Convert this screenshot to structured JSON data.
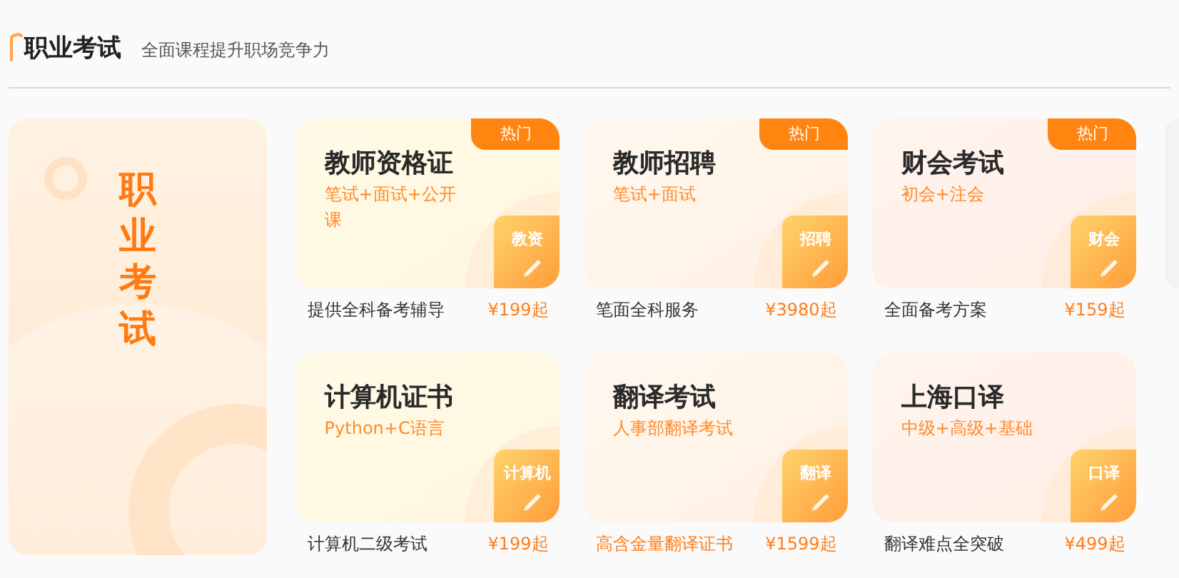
{
  "header": {
    "title": "职业考试",
    "subtitle": "全面课程提升职场竞争力"
  },
  "banner": {
    "title": "职业考试"
  },
  "cards": [
    {
      "title": "教师资格证",
      "subtitle": "笔试+面试+公开课",
      "badge": "热门",
      "icon_label": "教资",
      "caption": "提供全科备考辅导",
      "price": "¥199起",
      "highlighted": false
    },
    {
      "title": "教师招聘",
      "subtitle": "笔试+面试",
      "badge": "热门",
      "icon_label": "招聘",
      "caption": "笔面全科服务",
      "price": "¥3980起",
      "highlighted": false
    },
    {
      "title": "财会考试",
      "subtitle": "初会+注会",
      "badge": "热门",
      "icon_label": "财会",
      "caption": "全面备考方案",
      "price": "¥159起",
      "highlighted": false
    },
    {
      "title": "计算机证书",
      "subtitle": "Python+C语言",
      "icon_label": "计算机",
      "caption": "计算机二级考试",
      "price": "¥199起",
      "highlighted": false
    },
    {
      "title": "翻译考试",
      "subtitle": "人事部翻译考试",
      "icon_label": "翻译",
      "caption": "高含金量翻译证书",
      "price": "¥1599起",
      "highlighted": true
    },
    {
      "title": "上海口译",
      "subtitle": "中级+高级+基础",
      "icon_label": "口译",
      "caption": "翻译难点全突破",
      "price": "¥499起",
      "highlighted": false
    }
  ]
}
